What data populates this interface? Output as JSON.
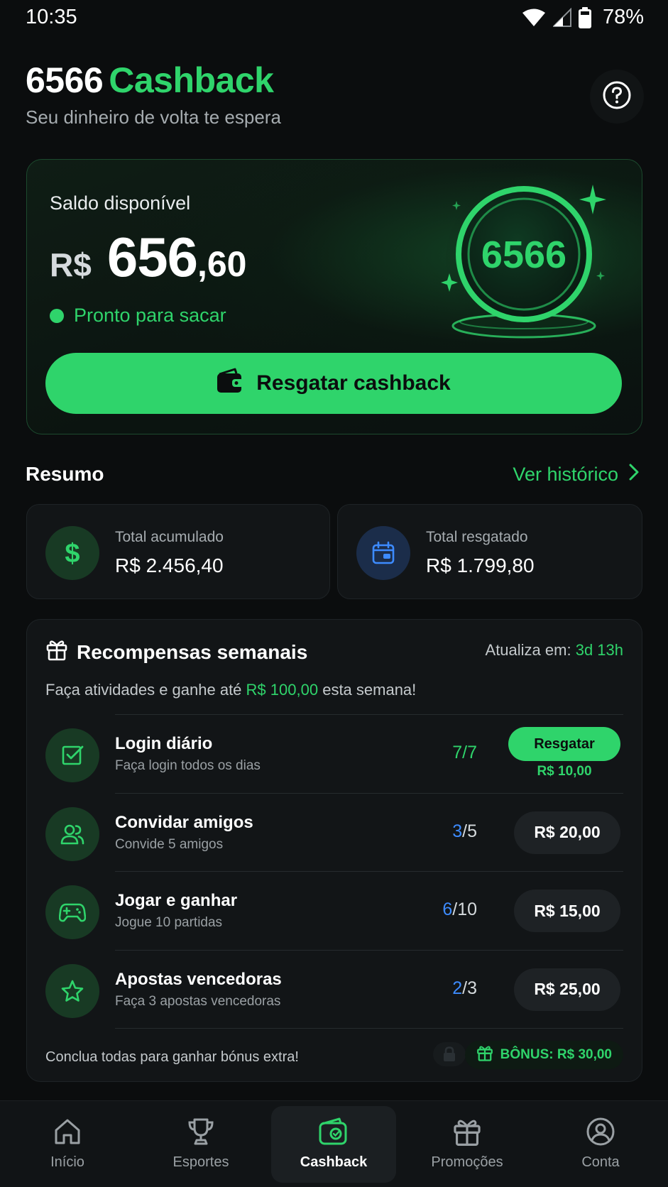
{
  "status_bar": {
    "time": "10:35",
    "battery": "78%",
    "icons": [
      "wifi-icon",
      "signal-icon",
      "battery-icon"
    ]
  },
  "header": {
    "brand": "6566",
    "accent": "Cashback",
    "subtitle": "Seu dinheiro de volta te espera",
    "help_icon": "help-circle-icon"
  },
  "balance": {
    "label": "Saldo disponível",
    "currency": "R$",
    "integer": "656",
    "decimal": ",60",
    "status": "Pronto para sacar",
    "coin_text": "6566",
    "redeem_label": "Resgatar cashback"
  },
  "summary": {
    "title": "Resumo",
    "history_link": "Ver histórico",
    "cards": [
      {
        "label": "Total acumulado",
        "value": "R$ 2.456,40",
        "icon": "dollar-icon"
      },
      {
        "label": "Total resgatado",
        "value": "R$ 1.799,80",
        "icon": "calendar-wallet-icon"
      }
    ]
  },
  "weekly": {
    "title": "Recompensas semanais",
    "refresh_label": "Atualiza em:",
    "refresh_time": "3d 13h",
    "desc_prefix": "Faça atividades e ganhe até",
    "desc_amount": "R$ 100,00",
    "desc_suffix": "esta semana!",
    "tasks": [
      {
        "title": "Login diário",
        "subtitle": "Faça login todos os dias",
        "progress_done": "7",
        "progress_total": "7",
        "action": "Resgatar",
        "reward": "R$ 10,00",
        "icon": "check-square-icon"
      },
      {
        "title": "Convidar amigos",
        "subtitle": "Convide 5 amigos",
        "progress_done": "3",
        "progress_total": "5",
        "reward": "R$ 20,00",
        "icon": "users-icon"
      },
      {
        "title": "Jogar e ganhar",
        "subtitle": "Jogue 10 partidas",
        "progress_done": "6",
        "progress_total": "10",
        "reward": "R$ 15,00",
        "icon": "gamepad-icon"
      },
      {
        "title": "Apostas vencedoras",
        "subtitle": "Faça 3 apostas vencedoras",
        "progress_done": "2",
        "progress_total": "3",
        "reward": "R$ 25,00",
        "icon": "star-icon"
      }
    ],
    "footer_text": "Conclua todas para ganhar bónus extra!",
    "bonus_label": "BÔNUS: R$ 30,00"
  },
  "nav": {
    "items": [
      {
        "label": "Início",
        "icon": "home-icon"
      },
      {
        "label": "Esportes",
        "icon": "trophy-icon"
      },
      {
        "label": "Cashback",
        "icon": "cashback-wallet-icon",
        "active": true
      },
      {
        "label": "Promoções",
        "icon": "gift-icon"
      },
      {
        "label": "Conta",
        "icon": "user-circle-icon"
      }
    ]
  },
  "colors": {
    "accent": "#2fd46b",
    "background": "#0b0d0e",
    "card": "#121517",
    "progress_blue": "#3d8bff"
  }
}
